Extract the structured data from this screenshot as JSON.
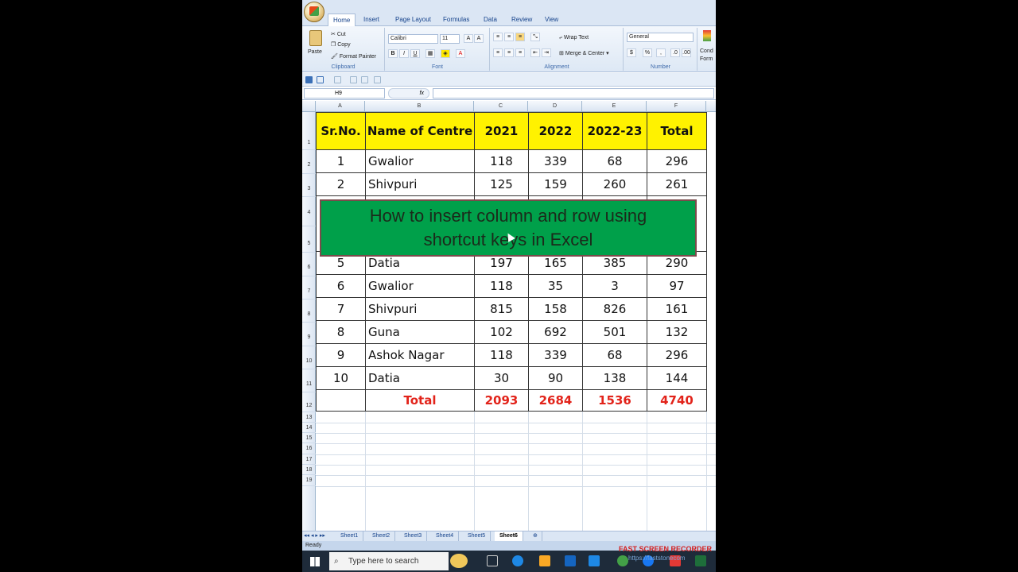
{
  "ribbon": {
    "tabs": [
      "Home",
      "Insert",
      "Page Layout",
      "Formulas",
      "Data",
      "Review",
      "View"
    ],
    "clipboard": {
      "paste": "Paste",
      "cut": "Cut",
      "copy": "Copy",
      "format_painter": "Format Painter",
      "label": "Clipboard"
    },
    "font": {
      "name": "Calibri",
      "size": "11",
      "label": "Font"
    },
    "alignment": {
      "wrap": "Wrap Text",
      "merge": "Merge & Center",
      "label": "Alignment"
    },
    "number": {
      "format": "General",
      "label": "Number"
    },
    "styles": {
      "cond": "Cond",
      "format": "Form"
    }
  },
  "formula_bar": {
    "name_box": "H9",
    "fx": "fx"
  },
  "columns": [
    "A",
    "B",
    "C",
    "D",
    "E",
    "F"
  ],
  "row_numbers": [
    "1",
    "2",
    "3",
    "4",
    "5",
    "6",
    "7",
    "8",
    "9",
    "10",
    "11",
    "12",
    "13",
    "14",
    "15",
    "16",
    "17",
    "18",
    "19"
  ],
  "table": {
    "headers": [
      "Sr.No.",
      "Name of Centre",
      "2021",
      "2022",
      "2022-23",
      "Total"
    ],
    "rows": [
      [
        "1",
        "Gwalior",
        "118",
        "339",
        "68",
        "296"
      ],
      [
        "2",
        "Shivpuri",
        "125",
        "159",
        "260",
        "261"
      ],
      [
        "5",
        "Datia",
        "197",
        "165",
        "385",
        "290"
      ],
      [
        "6",
        "Gwalior",
        "118",
        "35",
        "3",
        "97"
      ],
      [
        "7",
        "Shivpuri",
        "815",
        "158",
        "826",
        "161"
      ],
      [
        "8",
        "Guna",
        "102",
        "692",
        "501",
        "132"
      ],
      [
        "9",
        "Ashok Nagar",
        "118",
        "339",
        "68",
        "296"
      ],
      [
        "10",
        "Datia",
        "30",
        "90",
        "138",
        "144"
      ]
    ],
    "total_row": {
      "label": "Total",
      "values": [
        "2093",
        "2684",
        "1536",
        "4740"
      ]
    }
  },
  "banner": {
    "line1": "How to insert column and row using",
    "line2": "shortcut keys in Excel"
  },
  "sheet_tabs": [
    "Sheet1",
    "Sheet2",
    "Sheet3",
    "Sheet4",
    "Sheet5",
    "Sheet6"
  ],
  "active_sheet": "Sheet6",
  "status": "Ready",
  "taskbar": {
    "search_placeholder": "Type here to search"
  },
  "overlay": {
    "recorder": "FAST SCREEN RECORDER",
    "url": "https://faststonecom"
  },
  "colors": {
    "header_fill": "#fff200",
    "total_text": "#e2231a",
    "banner_fill": "#00a04a"
  }
}
